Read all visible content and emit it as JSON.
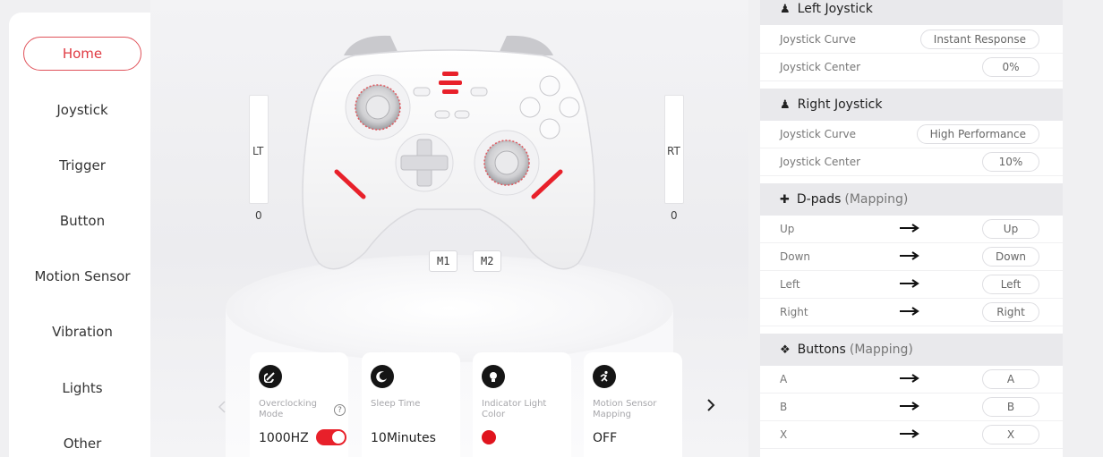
{
  "sidebar": {
    "items": [
      {
        "label": "Home",
        "active": true
      },
      {
        "label": "Joystick"
      },
      {
        "label": "Trigger"
      },
      {
        "label": "Button"
      },
      {
        "label": "Motion Sensor"
      },
      {
        "label": "Vibration"
      },
      {
        "label": "Lights"
      },
      {
        "label": "Other"
      }
    ]
  },
  "stage": {
    "lt_label": "LT",
    "lt_value": "0",
    "rt_label": "RT",
    "rt_value": "0",
    "m1_label": "M1",
    "m2_label": "M2"
  },
  "cards": [
    {
      "title": "Overclocking Mode",
      "value": "1000HZ",
      "icon": "speed-icon",
      "toggle_on": true
    },
    {
      "title": "Sleep Time",
      "value": "10Minutes",
      "icon": "moon-icon"
    },
    {
      "title": "Indicator Light Color",
      "value": "",
      "icon": "bulb-icon",
      "color": "#e0141e"
    },
    {
      "title": "Motion Sensor Mapping",
      "value": "OFF",
      "icon": "running-icon"
    }
  ],
  "panel": {
    "left_joystick": {
      "title": "Left Joystick",
      "rows": [
        {
          "label": "Joystick Curve",
          "value": "Instant Response"
        },
        {
          "label": "Joystick Center",
          "value": "0%"
        }
      ]
    },
    "right_joystick": {
      "title": "Right Joystick",
      "rows": [
        {
          "label": "Joystick Curve",
          "value": "High Performance"
        },
        {
          "label": "Joystick Center",
          "value": "10%"
        }
      ]
    },
    "dpads": {
      "title": "D-pads",
      "subtitle": "(Mapping)",
      "rows": [
        {
          "label": "Up",
          "value": "Up"
        },
        {
          "label": "Down",
          "value": "Down"
        },
        {
          "label": "Left",
          "value": "Left"
        },
        {
          "label": "Right",
          "value": "Right"
        }
      ]
    },
    "buttons": {
      "title": "Buttons",
      "subtitle": "(Mapping)",
      "rows": [
        {
          "label": "A",
          "value": "A"
        },
        {
          "label": "B",
          "value": "B"
        },
        {
          "label": "X",
          "value": "X"
        }
      ]
    }
  },
  "colors": {
    "accent": "#e8202a",
    "panel_header": "#e9e9ec"
  }
}
